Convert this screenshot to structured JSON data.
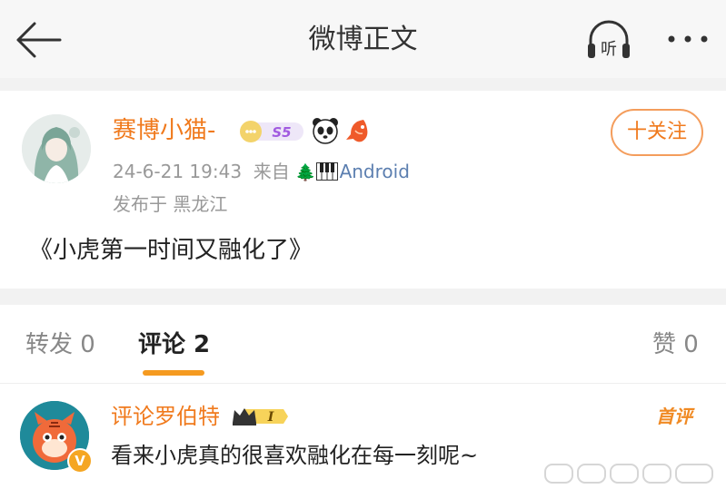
{
  "header": {
    "title": "微博正文",
    "listen_label": "听",
    "back_icon": "arrow-left-icon",
    "listen_icon": "headphones-icon",
    "more_icon": "more-dots-icon"
  },
  "post": {
    "username": "赛博小猫-",
    "vip_level": "S5",
    "timestamp": "24-6-21 19:43",
    "source_prefix": "来自",
    "source_emoji_tree": "🌲",
    "source_app": "Android",
    "location": "发布于 黑龙江",
    "follow_label": "十关注",
    "text": "《小虎第一时间又融化了》"
  },
  "tabs": {
    "reposts": "转发 0",
    "comments": "评论 2",
    "likes": "赞 0"
  },
  "comment": {
    "username": "评论罗伯特",
    "badge_level": "I",
    "first_tag": "首评",
    "text": "看来小虎真的很喜欢融化在每一刻呢~",
    "verified_mark": "V"
  },
  "colors": {
    "accent": "#f07a1d",
    "tab_underline": "#f59a20",
    "background": "#f2f2f2"
  }
}
